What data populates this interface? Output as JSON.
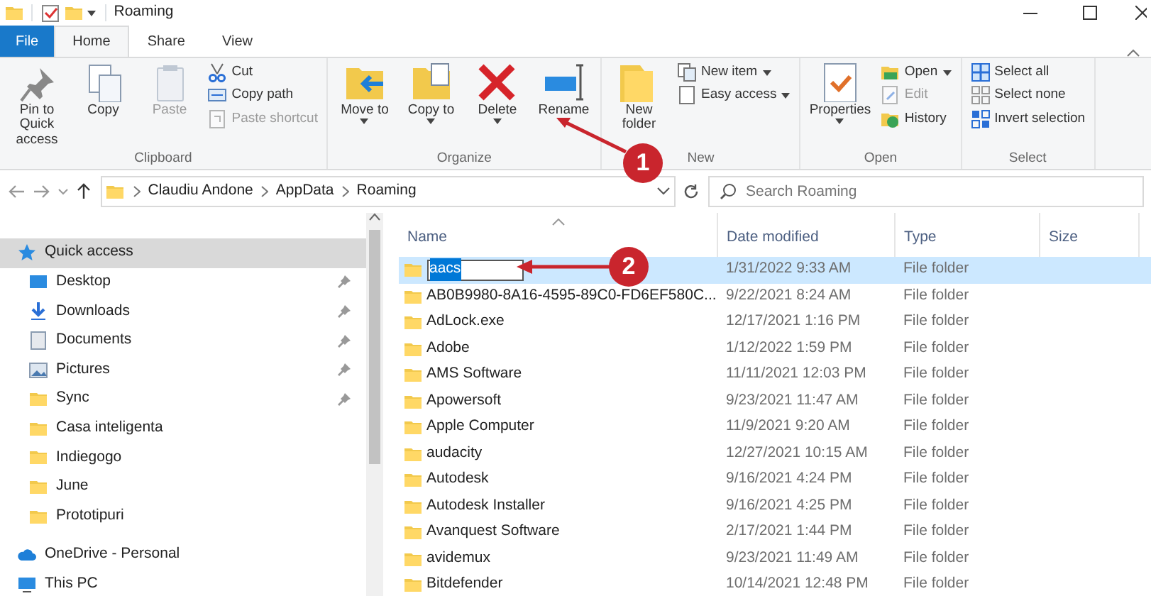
{
  "window": {
    "title": "Roaming"
  },
  "ribbon_tabs": [
    {
      "label": "File",
      "kind": "file",
      "selected": false
    },
    {
      "label": "Home",
      "kind": "tab",
      "selected": true
    },
    {
      "label": "Share",
      "kind": "tab",
      "selected": false
    },
    {
      "label": "View",
      "kind": "tab",
      "selected": false
    }
  ],
  "ribbon_groups": [
    {
      "label": "Clipboard",
      "buttons": [
        {
          "kind": "large",
          "label": "Pin to Quick access",
          "dropdown": false,
          "disabled": false
        },
        {
          "kind": "large",
          "label": "Copy",
          "dropdown": false,
          "disabled": false
        },
        {
          "kind": "large",
          "label": "Paste",
          "dropdown": false,
          "disabled": true
        },
        {
          "kind": "small",
          "label": "Cut",
          "dropdown": false,
          "disabled": false
        },
        {
          "kind": "small",
          "label": "Copy path",
          "dropdown": false,
          "disabled": false
        },
        {
          "kind": "small",
          "label": "Paste shortcut",
          "dropdown": false,
          "disabled": true
        }
      ]
    },
    {
      "label": "Organize",
      "buttons": [
        {
          "kind": "large",
          "label": "Move to",
          "dropdown": true,
          "disabled": false
        },
        {
          "kind": "large",
          "label": "Copy to",
          "dropdown": true,
          "disabled": false
        },
        {
          "kind": "large",
          "label": "Delete",
          "dropdown": true,
          "disabled": false
        },
        {
          "kind": "large",
          "label": "Rename",
          "dropdown": false,
          "disabled": false
        }
      ]
    },
    {
      "label": "New",
      "buttons": [
        {
          "kind": "large",
          "label": "New folder",
          "dropdown": false,
          "disabled": false
        },
        {
          "kind": "small",
          "label": "New item",
          "dropdown": true,
          "disabled": false
        },
        {
          "kind": "small",
          "label": "Easy access",
          "dropdown": true,
          "disabled": false
        }
      ]
    },
    {
      "label": "Open",
      "buttons": [
        {
          "kind": "large",
          "label": "Properties",
          "dropdown": true,
          "disabled": false
        },
        {
          "kind": "small",
          "label": "Open",
          "dropdown": true,
          "disabled": false
        },
        {
          "kind": "small",
          "label": "Edit",
          "dropdown": false,
          "disabled": true
        },
        {
          "kind": "small",
          "label": "History",
          "dropdown": false,
          "disabled": false
        }
      ]
    },
    {
      "label": "Select",
      "buttons": [
        {
          "kind": "small",
          "label": "Select all",
          "dropdown": false,
          "disabled": false
        },
        {
          "kind": "small",
          "label": "Select none",
          "dropdown": false,
          "disabled": false
        },
        {
          "kind": "small",
          "label": "Invert selection",
          "dropdown": false,
          "disabled": false
        }
      ]
    }
  ],
  "address_bar": {
    "crumbs": [
      "Claudiu Andone",
      "AppData",
      "Roaming"
    ]
  },
  "search": {
    "placeholder": "Search Roaming"
  },
  "sidebar": {
    "items": [
      {
        "label": "Quick access",
        "kind": "star",
        "selected": true,
        "children": [
          {
            "label": "Desktop",
            "kind": "desktop",
            "pinned": true
          },
          {
            "label": "Downloads",
            "kind": "download",
            "pinned": true
          },
          {
            "label": "Documents",
            "kind": "documents",
            "pinned": true
          },
          {
            "label": "Pictures",
            "kind": "pictures",
            "pinned": true
          },
          {
            "label": "Sync",
            "kind": "folder",
            "pinned": true
          },
          {
            "label": "Casa inteligenta",
            "kind": "folder",
            "pinned": false
          },
          {
            "label": "Indiegogo",
            "kind": "folder",
            "pinned": false
          },
          {
            "label": "June",
            "kind": "folder",
            "pinned": false
          },
          {
            "label": "Prototipuri",
            "kind": "folder",
            "pinned": false
          }
        ]
      },
      {
        "label": "OneDrive - Personal",
        "kind": "cloud",
        "selected": false
      },
      {
        "label": "This PC",
        "kind": "pc",
        "selected": false
      }
    ]
  },
  "table": {
    "columns": [
      "Name",
      "Date modified",
      "Type",
      "Size"
    ],
    "rows": [
      {
        "name": "aacs",
        "date": "1/31/2022 9:33 AM",
        "type": "File folder",
        "selected": true,
        "editing": true
      },
      {
        "name": "AB0B9980-8A16-4595-89C0-FD6EF580C...",
        "date": "9/22/2021 8:24 AM",
        "type": "File folder",
        "selected": false,
        "editing": false
      },
      {
        "name": "AdLock.exe",
        "date": "12/17/2021 1:16 PM",
        "type": "File folder",
        "selected": false,
        "editing": false
      },
      {
        "name": "Adobe",
        "date": "1/12/2022 1:59 PM",
        "type": "File folder",
        "selected": false,
        "editing": false
      },
      {
        "name": "AMS Software",
        "date": "11/11/2021 12:03 PM",
        "type": "File folder",
        "selected": false,
        "editing": false
      },
      {
        "name": "Apowersoft",
        "date": "9/23/2021 11:47 AM",
        "type": "File folder",
        "selected": false,
        "editing": false
      },
      {
        "name": "Apple Computer",
        "date": "11/9/2021 9:20 AM",
        "type": "File folder",
        "selected": false,
        "editing": false
      },
      {
        "name": "audacity",
        "date": "12/27/2021 10:15 AM",
        "type": "File folder",
        "selected": false,
        "editing": false
      },
      {
        "name": "Autodesk",
        "date": "9/16/2021 4:24 PM",
        "type": "File folder",
        "selected": false,
        "editing": false
      },
      {
        "name": "Autodesk Installer",
        "date": "9/16/2021 4:25 PM",
        "type": "File folder",
        "selected": false,
        "editing": false
      },
      {
        "name": "Avanquest Software",
        "date": "2/17/2021 1:44 PM",
        "type": "File folder",
        "selected": false,
        "editing": false
      },
      {
        "name": "avidemux",
        "date": "9/23/2021 11:49 AM",
        "type": "File folder",
        "selected": false,
        "editing": false
      },
      {
        "name": "Bitdefender",
        "date": "10/14/2021 12:48 PM",
        "type": "File folder",
        "selected": false,
        "editing": false
      }
    ]
  },
  "annotations": [
    {
      "label": "1"
    },
    {
      "label": "2"
    }
  ]
}
